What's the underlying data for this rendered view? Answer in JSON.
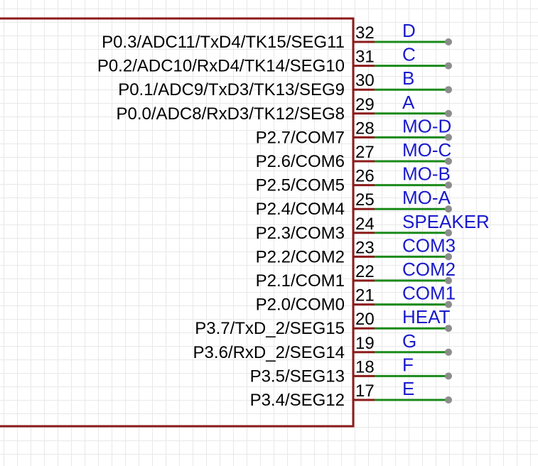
{
  "colors": {
    "body_outline": "#8b1a1a",
    "pin_stub": "#8b1a1a",
    "wire": "#1a8a1a",
    "wire_endpoint": "#8c8c8c",
    "net_label": "#1a1acd",
    "text": "#000000"
  },
  "pins": [
    {
      "number": "32",
      "name": "P0.3/ADC11/TxD4/TK15/SEG11",
      "net": "D"
    },
    {
      "number": "31",
      "name": "P0.2/ADC10/RxD4/TK14/SEG10",
      "net": "C"
    },
    {
      "number": "30",
      "name": "P0.1/ADC9/TxD3/TK13/SEG9",
      "net": "B"
    },
    {
      "number": "29",
      "name": "P0.0/ADC8/RxD3/TK12/SEG8",
      "net": "A"
    },
    {
      "number": "28",
      "name": "P2.7/COM7",
      "net": "MO-D"
    },
    {
      "number": "27",
      "name": "P2.6/COM6",
      "net": "MO-C"
    },
    {
      "number": "26",
      "name": "P2.5/COM5",
      "net": "MO-B"
    },
    {
      "number": "25",
      "name": "P2.4/COM4",
      "net": "MO-A"
    },
    {
      "number": "24",
      "name": "P2.3/COM3",
      "net": "SPEAKER"
    },
    {
      "number": "23",
      "name": "P2.2/COM2",
      "net": "COM3"
    },
    {
      "number": "22",
      "name": "P2.1/COM1",
      "net": "COM2"
    },
    {
      "number": "21",
      "name": "P2.0/COM0",
      "net": "COM1"
    },
    {
      "number": "20",
      "name": "P3.7/TxD_2/SEG15",
      "net": "HEAT"
    },
    {
      "number": "19",
      "name": "P3.6/RxD_2/SEG14",
      "net": "G"
    },
    {
      "number": "18",
      "name": "P3.5/SEG13",
      "net": "F"
    },
    {
      "number": "17",
      "name": "P3.4/SEG12",
      "net": "E"
    }
  ]
}
